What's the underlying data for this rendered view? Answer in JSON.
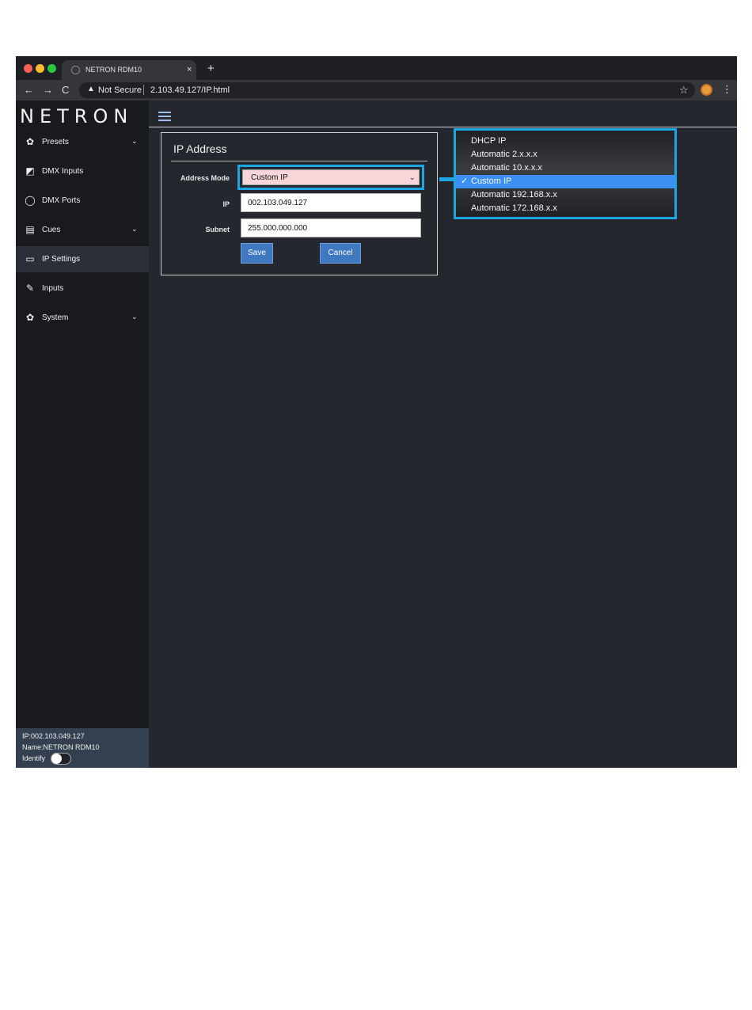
{
  "browser": {
    "tab_title": "NETRON RDM10",
    "tab_close": "×",
    "new_tab": "+",
    "nav_back": "←",
    "nav_forward": "→",
    "nav_reload": "C",
    "security_warning_icon": "▲",
    "security_label": "Not Secure",
    "url": "2.103.49.127/IP.html",
    "bookmark_icon": "☆",
    "menu_icon": "⋮"
  },
  "sidebar": {
    "logo_text": "NETRON",
    "items": [
      {
        "label": "Presets",
        "icon": "gear-icon",
        "glyph": "✿",
        "expandable": true,
        "chevron": "⌄"
      },
      {
        "label": "DMX Inputs",
        "icon": "image-icon",
        "glyph": "◩",
        "expandable": false
      },
      {
        "label": "DMX Ports",
        "icon": "power-icon",
        "glyph": "◯",
        "expandable": false
      },
      {
        "label": "Cues",
        "icon": "film-icon",
        "glyph": "▤",
        "expandable": true,
        "chevron": "⌄"
      },
      {
        "label": "IP Settings",
        "icon": "laptop-icon",
        "glyph": "▭",
        "expandable": false,
        "active": true
      },
      {
        "label": "Inputs",
        "icon": "plug-icon",
        "glyph": "✎",
        "expandable": false
      },
      {
        "label": "System",
        "icon": "gear-icon",
        "glyph": "✿",
        "expandable": true,
        "chevron": "⌄"
      }
    ],
    "footer": {
      "ip_line": "IP:002.103.049.127",
      "name_line": "Name:NETRON RDM10",
      "identify_label": "Identify",
      "identify_on": false
    }
  },
  "ip_panel": {
    "title": "IP Address",
    "address_mode_label": "Address Mode",
    "address_mode_value": "Custom IP",
    "select_chevron": "⌄",
    "ip_label": "IP",
    "ip_value": "002.103.049.127",
    "subnet_label": "Subnet",
    "subnet_value": "255.000.000.000",
    "save_label": "Save",
    "cancel_label": "Cancel"
  },
  "dropdown": {
    "options": [
      {
        "label": "DHCP IP",
        "selected": false
      },
      {
        "label": "Automatic 2.x.x.x",
        "selected": false
      },
      {
        "label": "Automatic 10.x.x.x",
        "selected": false
      },
      {
        "label": "Custom IP",
        "selected": true,
        "check": "✓"
      },
      {
        "label": "Automatic 192.168.x.x",
        "selected": false
      },
      {
        "label": "Automatic 172.168.x.x",
        "selected": false
      }
    ]
  },
  "colors": {
    "highlight": "#1ea6e4",
    "selected_option": "#3c8ff3",
    "button": "#3f78c0",
    "select_bg": "#f7d5d8"
  }
}
